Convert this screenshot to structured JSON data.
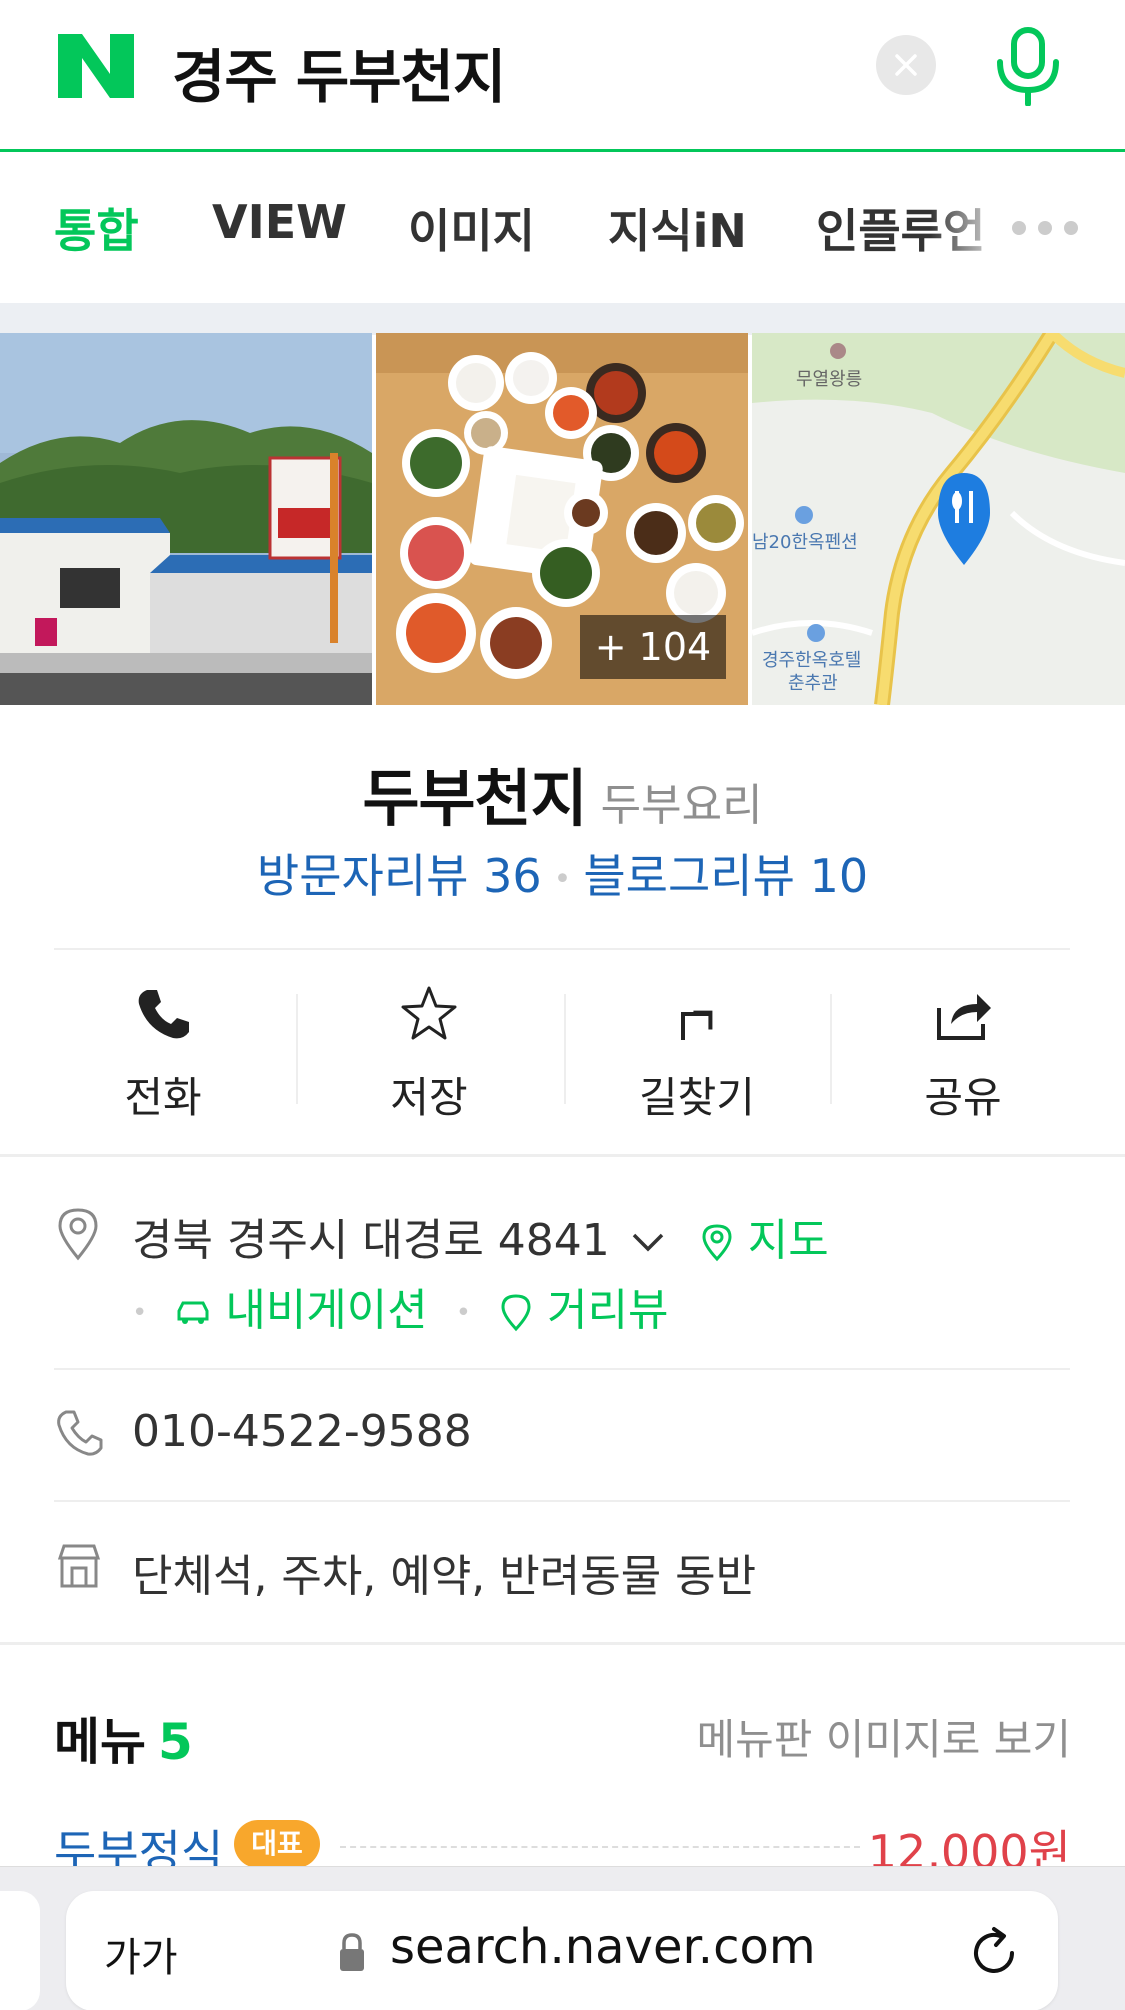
{
  "header": {
    "logo_letter": "N",
    "search_query": "경주 두부천지"
  },
  "tabs": [
    {
      "label": "통합",
      "active": true
    },
    {
      "label": "VIEW",
      "active": false
    },
    {
      "label": "이미지",
      "active": false
    },
    {
      "label": "지식iN",
      "active": false
    },
    {
      "label": "인플루언",
      "active": false
    }
  ],
  "photos": {
    "more_count": "+ 104",
    "map_labels": [
      "무열왕릉",
      "남20한옥펜션",
      "경주한옥호텔 춘추관"
    ]
  },
  "place": {
    "name": "두부천지",
    "category": "두부요리",
    "visitor_reviews": "방문자리뷰 36",
    "blog_reviews": "블로그리뷰 10"
  },
  "actions": [
    {
      "label": "전화",
      "icon": "phone-icon"
    },
    {
      "label": "저장",
      "icon": "star-icon"
    },
    {
      "label": "길찾기",
      "icon": "directions-icon"
    },
    {
      "label": "공유",
      "icon": "share-icon"
    }
  ],
  "info": {
    "address": "경북 경주시 대경로 4841",
    "map_link": "지도",
    "navigation_link": "내비게이션",
    "streetview_link": "거리뷰",
    "phone": "010-4522-9588",
    "facilities": "단체석, 주차, 예약, 반려동물 동반"
  },
  "menu": {
    "title": "메뉴",
    "count": "5",
    "view_image_link": "메뉴판 이미지로 보기",
    "items": [
      {
        "name": "두부정식",
        "badge": "대표",
        "price": "12,000원"
      }
    ]
  },
  "browser": {
    "text_size_label": "가가",
    "url": "search.naver.com"
  },
  "colors": {
    "naver_green": "#03c75a",
    "link_blue": "#1d65b6",
    "price_red": "#e0424a",
    "badge_orange": "#f8a72c"
  }
}
